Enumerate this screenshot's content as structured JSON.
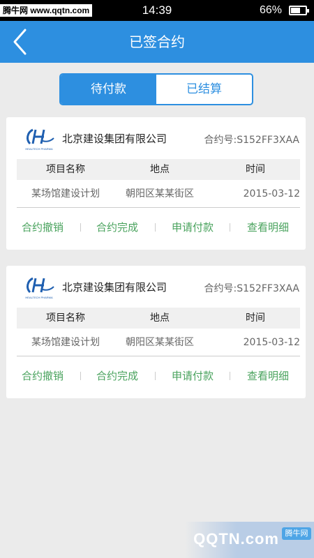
{
  "status_bar": {
    "watermark": "腾牛网 www.qqtn.com",
    "time": "14:39",
    "battery_percent": "66%",
    "battery_level": 0.66
  },
  "nav": {
    "title": "已签合约",
    "back_icon": "chevron-left-icon"
  },
  "tabs": [
    {
      "label": "待付款",
      "active": true
    },
    {
      "label": "已结算",
      "active": false
    }
  ],
  "columns": [
    "项目名称",
    "地点",
    "时间"
  ],
  "contracts": [
    {
      "company": "北京建设集团有限公司",
      "contract_no": "合约号:S152FF3XAA",
      "logo_text": "HEALTECH PHARMA",
      "project": "某场馆建设计划",
      "location": "朝阳区某某街区",
      "date": "2015-03-12",
      "actions": [
        "合约撤销",
        "合约完成",
        "申请付款",
        "查看明细"
      ]
    },
    {
      "company": "北京建设集团有限公司",
      "contract_no": "合约号:S152FF3XAA",
      "logo_text": "HEALTECH PHARMA",
      "project": "某场馆建设计划",
      "location": "朝阳区某某街区",
      "date": "2015-03-12",
      "actions": [
        "合约撤销",
        "合约完成",
        "申请付款",
        "查看明细"
      ]
    }
  ],
  "footer_watermark": {
    "brand": "QQTN.com",
    "badge": "腾牛网"
  },
  "colors": {
    "accent": "#2d8fe0",
    "action_green": "#4aa35e"
  }
}
